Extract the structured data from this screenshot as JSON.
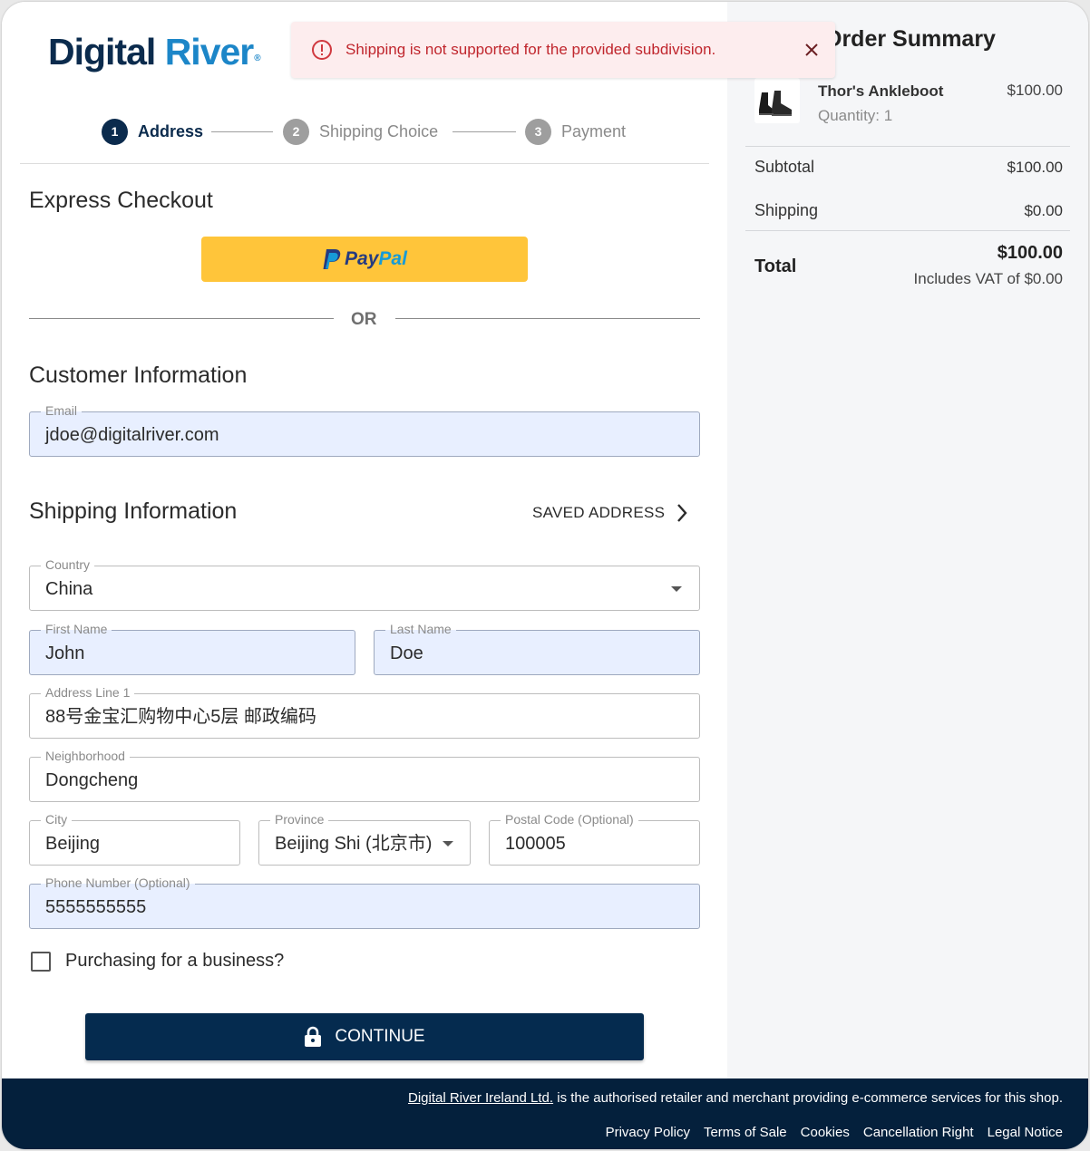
{
  "brand": {
    "logo_part1": "Digital",
    "logo_part2": "River",
    "logo_mark": "®"
  },
  "alert": {
    "message": "Shipping is not supported for the provided subdivision."
  },
  "steps": [
    {
      "number": "1",
      "label": "Address"
    },
    {
      "number": "2",
      "label": "Shipping Choice"
    },
    {
      "number": "3",
      "label": "Payment"
    }
  ],
  "express": {
    "title": "Express Checkout",
    "paypal_part1": "Pay",
    "paypal_part2": "Pal",
    "or_label": "OR"
  },
  "customer": {
    "title": "Customer Information",
    "email_label": "Email",
    "email_value": "jdoe@digitalriver.com"
  },
  "shipping": {
    "title": "Shipping Information",
    "saved_address": "SAVED ADDRESS",
    "country_label": "Country",
    "country_value": "China",
    "first_name_label": "First Name",
    "first_name_value": "John",
    "last_name_label": "Last Name",
    "last_name_value": "Doe",
    "address1_label": "Address Line 1",
    "address1_value": "88号金宝汇购物中心5层 邮政编码",
    "neighborhood_label": "Neighborhood",
    "neighborhood_value": "Dongcheng",
    "city_label": "City",
    "city_value": "Beijing",
    "province_label": "Province",
    "province_value": "Beijing Shi (北京市)",
    "postal_label": "Postal Code (Optional)",
    "postal_value": "100005",
    "phone_label": "Phone Number (Optional)",
    "phone_value": "5555555555",
    "business_label": "Purchasing for a business?",
    "business_checked": false
  },
  "continue_label": "CONTINUE",
  "summary": {
    "title": "Order Summary",
    "product_name": "Thor's Ankleboot",
    "product_quantity": "Quantity: 1",
    "product_price": "$100.00",
    "subtotal_label": "Subtotal",
    "subtotal_value": "$100.00",
    "shipping_label": "Shipping",
    "shipping_value": "$0.00",
    "total_label": "Total",
    "total_value": "$100.00",
    "vat_note": "Includes VAT of $0.00"
  },
  "footer": {
    "retailer_link": "Digital River Ireland Ltd.",
    "retailer_text": " is the authorised retailer and merchant providing e-commerce services for this shop.",
    "links": [
      "Privacy Policy",
      "Terms of Sale",
      "Cookies",
      "Cancellation Right",
      "Legal Notice"
    ]
  },
  "colors": {
    "brand_navy": "#0b2b4d",
    "brand_blue": "#1c86c8",
    "paypal_yellow": "#ffc53a",
    "alert_red": "#c0262d",
    "alert_bg": "#fdedee",
    "field_filled_bg": "#e8efff",
    "button_navy": "#052b4f",
    "footer_bg": "#04203c"
  }
}
